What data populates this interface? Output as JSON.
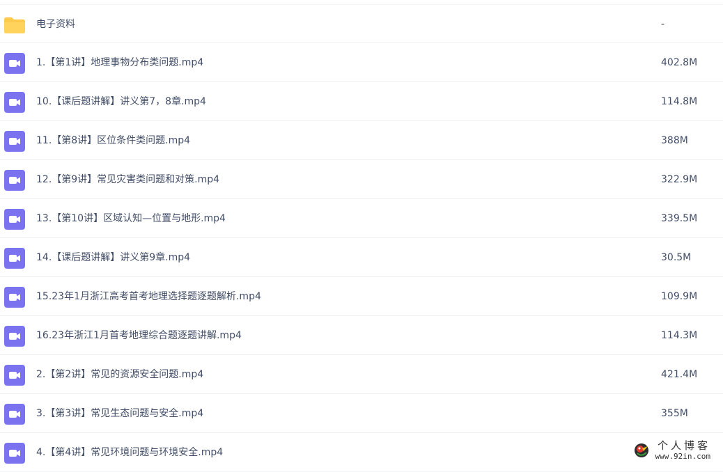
{
  "colors": {
    "folder": "#ffc94c",
    "video": "#7b72f0",
    "text": "#424e67",
    "divider": "#f1f2f4"
  },
  "files": [
    {
      "name": "电子资料",
      "size": "-",
      "icon": "folder-icon"
    },
    {
      "name": "1.【第1讲】地理事物分布类问题.mp4",
      "size": "402.8M",
      "icon": "video-file-icon"
    },
    {
      "name": "10.【课后题讲解】讲义第7，8章.mp4",
      "size": "114.8M",
      "icon": "video-file-icon"
    },
    {
      "name": "11.【第8讲】区位条件类问题.mp4",
      "size": "388M",
      "icon": "video-file-icon"
    },
    {
      "name": "12.【第9讲】常见灾害类问题和对策.mp4",
      "size": "322.9M",
      "icon": "video-file-icon"
    },
    {
      "name": "13.【第10讲】区域认知—位置与地形.mp4",
      "size": "339.5M",
      "icon": "video-file-icon"
    },
    {
      "name": "14.【课后题讲解】讲义第9章.mp4",
      "size": "30.5M",
      "icon": "video-file-icon"
    },
    {
      "name": "15.23年1月浙江高考首考地理选择题逐题解析.mp4",
      "size": "109.9M",
      "icon": "video-file-icon"
    },
    {
      "name": "16.23年浙江1月首考地理综合题逐题讲解.mp4",
      "size": "114.3M",
      "icon": "video-file-icon"
    },
    {
      "name": "2.【第2讲】常见的资源安全问题.mp4",
      "size": "421.4M",
      "icon": "video-file-icon"
    },
    {
      "name": "3.【第3讲】常见生态问题与安全.mp4",
      "size": "355M",
      "icon": "video-file-icon"
    },
    {
      "name": "4.【第4讲】常见环境问题与环境安全.mp4",
      "size": "",
      "icon": "video-file-icon"
    }
  ],
  "watermark": {
    "title": "个人博客",
    "url": "www.92in.com"
  }
}
